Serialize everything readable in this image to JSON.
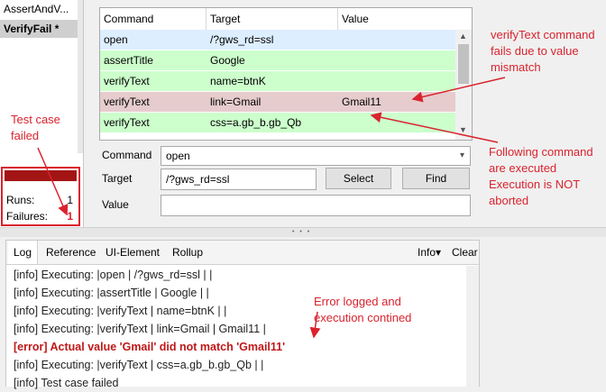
{
  "test_cases": [
    "AssertAndV...",
    "VerifyFail *"
  ],
  "stats": {
    "runs_label": "Runs:",
    "runs_value": "1",
    "failures_label": "Failures:",
    "failures_value": "1"
  },
  "table": {
    "headers": [
      "Command",
      "Target",
      "Value"
    ],
    "rows": [
      {
        "command": "open",
        "target": "/?gws_rd=ssl",
        "value": "",
        "status": "selected"
      },
      {
        "command": "assertTitle",
        "target": "Google",
        "value": "",
        "status": "passed"
      },
      {
        "command": "verifyText",
        "target": "name=btnK",
        "value": "",
        "status": "passed"
      },
      {
        "command": "verifyText",
        "target": "link=Gmail",
        "value": "Gmail11",
        "status": "failed"
      },
      {
        "command": "verifyText",
        "target": "css=a.gb_b.gb_Qb",
        "value": "",
        "status": "passed"
      }
    ]
  },
  "editor": {
    "command_label": "Command",
    "command_value": "open",
    "target_label": "Target",
    "target_value": "/?gws_rd=ssl",
    "value_label": "Value",
    "value_value": "",
    "select_button": "Select",
    "find_button": "Find"
  },
  "log": {
    "tabs": [
      "Log",
      "Reference",
      "UI-Element",
      "Rollup"
    ],
    "info_menu": "Info▾",
    "clear_button": "Clear",
    "lines": [
      {
        "text": "[info] Executing: |open | /?gws_rd=ssl | |",
        "level": "info"
      },
      {
        "text": "[info] Executing: |assertTitle | Google | |",
        "level": "info"
      },
      {
        "text": "[info] Executing: |verifyText | name=btnK | |",
        "level": "info"
      },
      {
        "text": "[info] Executing: |verifyText | link=Gmail | Gmail11 |",
        "level": "info"
      },
      {
        "text": "[error] Actual value 'Gmail' did not match 'Gmail11'",
        "level": "error"
      },
      {
        "text": "[info] Executing: |verifyText | css=a.gb_b.gb_Qb | |",
        "level": "info"
      },
      {
        "text": "[info] Test case failed",
        "level": "info"
      }
    ]
  },
  "annotations": {
    "test_failed": [
      "Test case",
      "failed"
    ],
    "verify_fails": [
      "verifyText command",
      "fails due to value",
      "mismatch"
    ],
    "following": [
      "Following command",
      "are executed",
      "Execution is NOT",
      "aborted"
    ],
    "error_logged": [
      "Error logged and",
      "execution contined"
    ]
  },
  "colors": {
    "passed": "#ccffcc",
    "failed": "#e6cccc",
    "selected": "#ddeeff",
    "annotation": "#d9232e",
    "error_text": "#c01818"
  }
}
